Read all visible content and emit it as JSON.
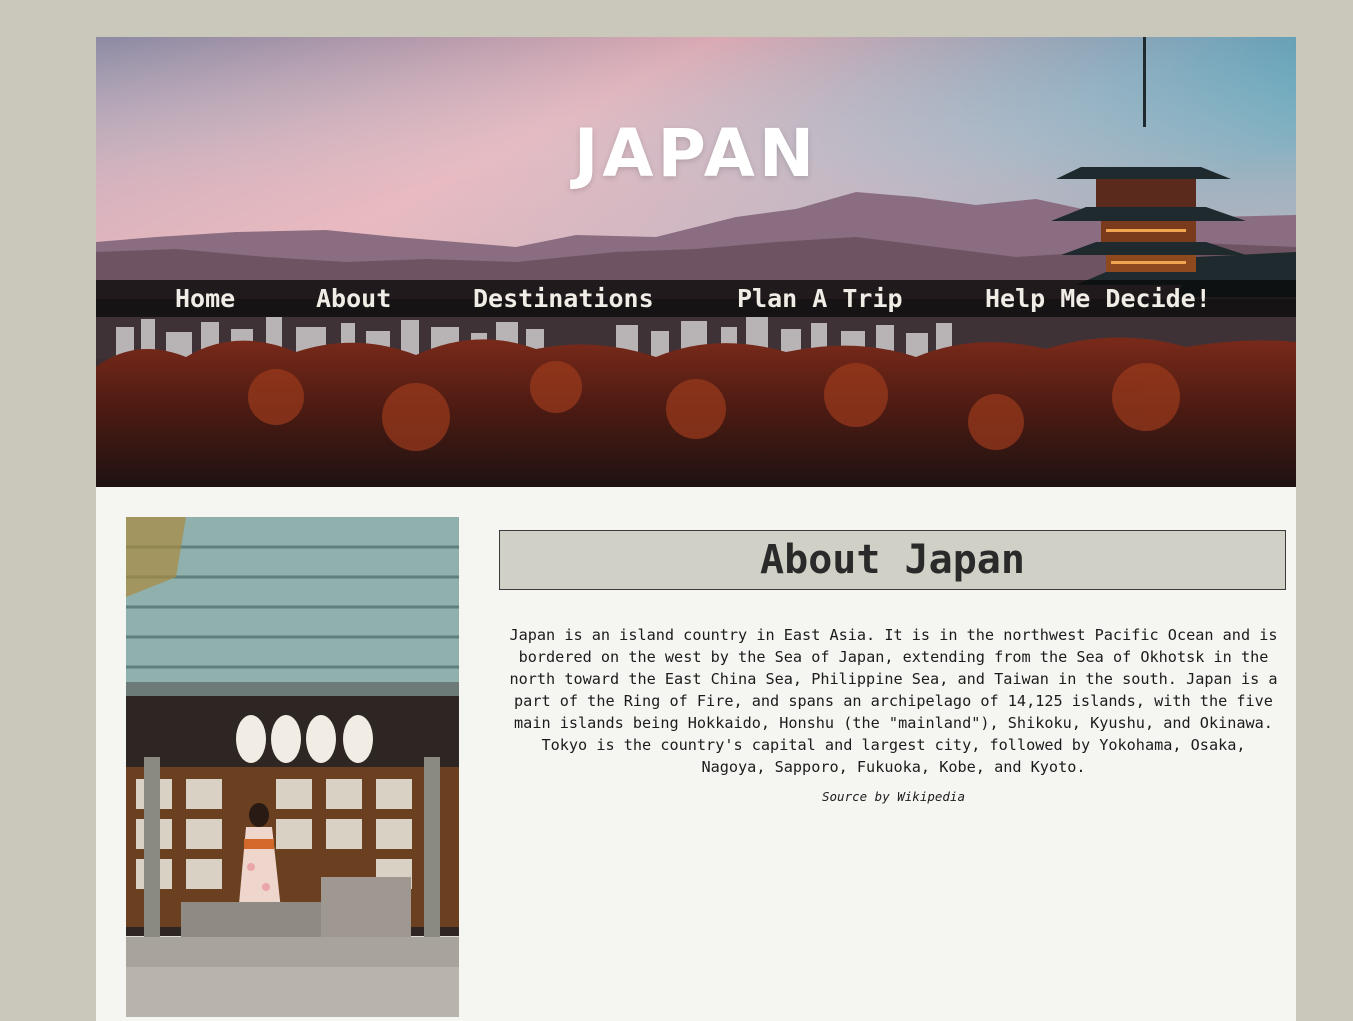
{
  "hero": {
    "title": "JAPAN"
  },
  "nav": {
    "items": [
      {
        "label": "Home"
      },
      {
        "label": "About"
      },
      {
        "label": "Destinations"
      },
      {
        "label": "Plan A Trip"
      },
      {
        "label": "Help Me Decide!"
      }
    ]
  },
  "about": {
    "heading": "About Japan",
    "body": "Japan is an island country in East Asia. It is in the northwest Pacific Ocean and is bordered on the west by the Sea of Japan, extending from the Sea of Okhotsk in the north toward the East China Sea, Philippine Sea, and Taiwan in the south. Japan is a part of the Ring of Fire, and spans an archipelago of 14,125 islands, with the five main islands being Hokkaido, Honshu (the \"mainland\"), Shikoku, Kyushu, and Okinawa. Tokyo is the country's capital and largest city, followed by Yokohama, Osaka, Nagoya, Sapporo, Fukuoka, Kobe, and Kyoto.",
    "source": "Source by Wikipedia"
  },
  "colors": {
    "background": "#c9c8bb",
    "page": "#f5f5f2",
    "heading_box": "#d0d0c6",
    "nav_bar": "#0a0a0a",
    "nav_text": "#f0ece6"
  }
}
